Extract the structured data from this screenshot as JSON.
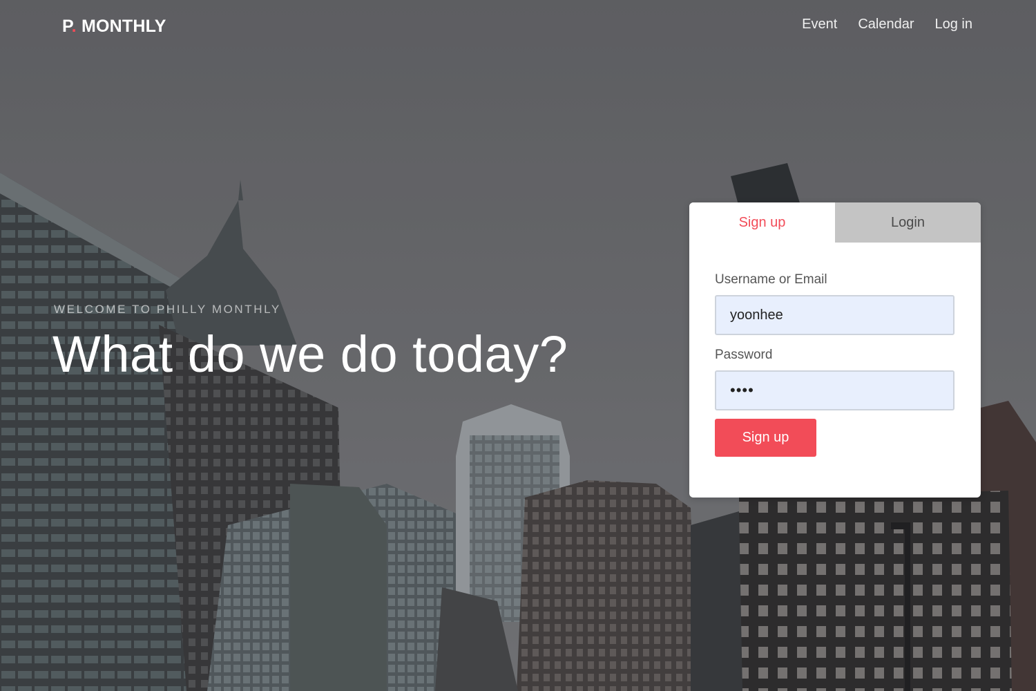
{
  "header": {
    "brand_prefix": "P",
    "brand_dot": ".",
    "brand_name": " MONTHLY",
    "nav": [
      {
        "label": "Event"
      },
      {
        "label": "Calendar"
      },
      {
        "label": "Log in"
      }
    ]
  },
  "hero": {
    "eyebrow": "WELCOME TO PHILLY MONTHLY",
    "headline": "What do we do today?"
  },
  "auth_card": {
    "tabs": [
      {
        "label": "Sign up",
        "active": true
      },
      {
        "label": "Login",
        "active": false
      }
    ],
    "username_label": "Username or Email",
    "username_value": "yoonhee",
    "password_label": "Password",
    "password_value": "1234",
    "submit_label": "Sign up"
  },
  "colors": {
    "accent": "#f24c58",
    "inactive_tab": "#c4c4c4",
    "field_fill": "#e8effd"
  }
}
